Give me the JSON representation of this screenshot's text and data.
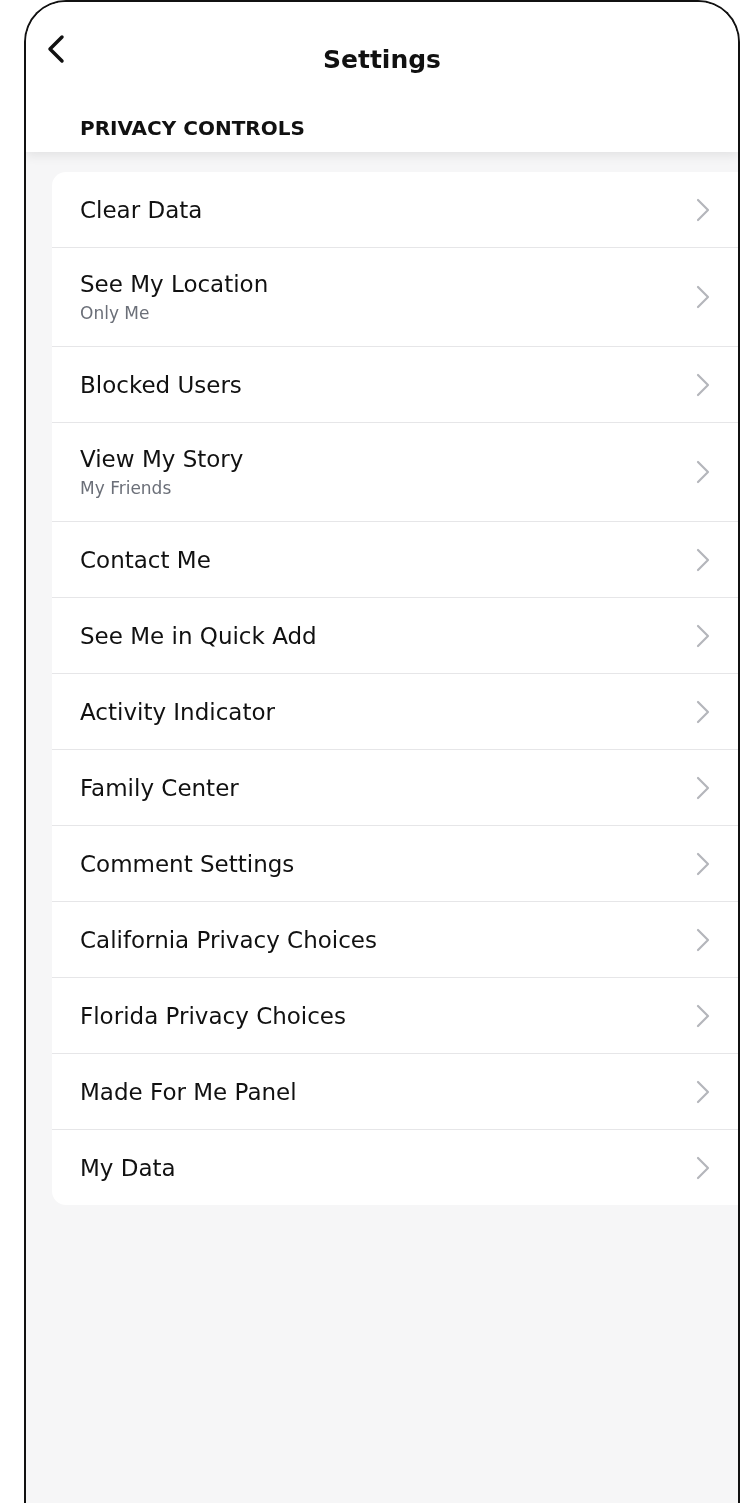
{
  "header": {
    "title": "Settings"
  },
  "section": {
    "title": "PRIVACY CONTROLS"
  },
  "items": [
    {
      "label": "Clear Data"
    },
    {
      "label": "See My Location",
      "value": "Only Me"
    },
    {
      "label": "Blocked Users"
    },
    {
      "label": "View My Story",
      "value": "My Friends"
    },
    {
      "label": "Contact Me"
    },
    {
      "label": "See Me in Quick Add"
    },
    {
      "label": "Activity Indicator"
    },
    {
      "label": "Family Center"
    },
    {
      "label": "Comment Settings"
    },
    {
      "label": "California Privacy Choices"
    },
    {
      "label": "Florida Privacy Choices"
    },
    {
      "label": "Made For Me Panel"
    },
    {
      "label": "My Data"
    }
  ]
}
